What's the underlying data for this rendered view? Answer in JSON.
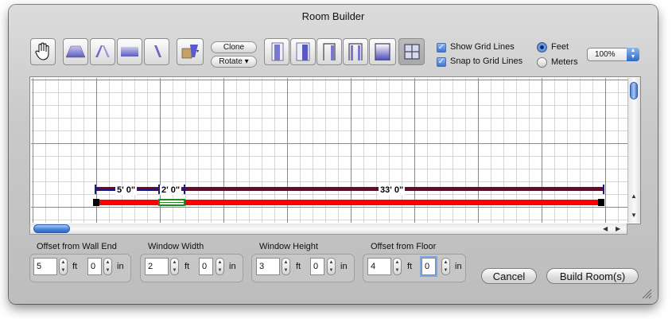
{
  "window": {
    "title": "Room Builder"
  },
  "toolbar": {
    "clone_label": "Clone",
    "rotate_label": "Rotate ▾"
  },
  "options": {
    "show_grid_lines": {
      "label": "Show Grid Lines",
      "checked": true
    },
    "snap_to_grid_lines": {
      "label": "Snap to Grid Lines",
      "checked": true
    },
    "units": {
      "feet_label": "Feet",
      "meters_label": "Meters",
      "selected": "Feet"
    },
    "zoom": "100%"
  },
  "wall": {
    "labels": [
      "5' 0\"",
      "2' 0\"",
      "33' 0\""
    ],
    "colors": {
      "wall": "#ff0000",
      "dimension": "#6a0a2a",
      "dimension_blue": "#1a1a8c",
      "window": "#1e8a1e"
    }
  },
  "fields": [
    {
      "label": "Offset from Wall End",
      "ft": "5",
      "in": "0",
      "ft_unit": "ft",
      "in_unit": "in"
    },
    {
      "label": "Window Width",
      "ft": "2",
      "in": "0",
      "ft_unit": "ft",
      "in_unit": "in"
    },
    {
      "label": "Window Height",
      "ft": "3",
      "in": "0",
      "ft_unit": "ft",
      "in_unit": "in"
    },
    {
      "label": "Offset from Floor",
      "ft": "4",
      "in": "0",
      "ft_unit": "ft",
      "in_unit": "in"
    }
  ],
  "actions": {
    "cancel_label": "Cancel",
    "build_label": "Build Room(s)"
  }
}
